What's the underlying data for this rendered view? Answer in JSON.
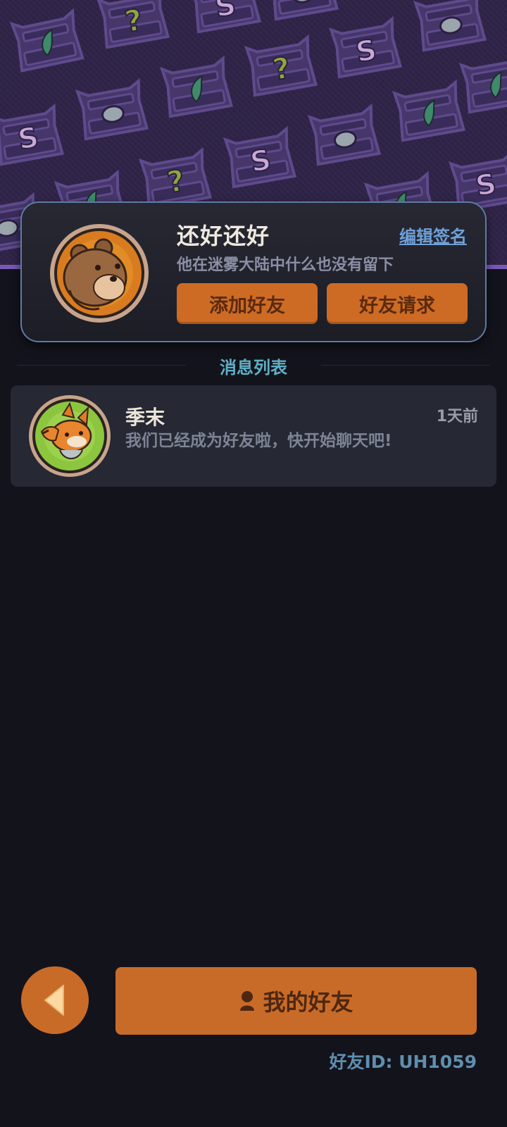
{
  "banner": {
    "tile_symbols": [
      "S",
      "?",
      "gem-icon",
      "leaf-icon"
    ],
    "colors": {
      "background": "#2f2448",
      "accent": "#7a58b8"
    }
  },
  "profile": {
    "name": "还好还好",
    "edit_signature_label": "编辑签名",
    "signature": "他在迷雾大陆中什么也没有留下",
    "add_friend_label": "添加好友",
    "friend_request_label": "好友请求",
    "avatar_icon": "bear-avatar-icon"
  },
  "messages": {
    "title": "消息列表",
    "items": [
      {
        "name": "季末",
        "time": "1天前",
        "preview": "我们已经成为好友啦，快开始聊天吧!",
        "avatar_icon": "fox-avatar-icon"
      }
    ]
  },
  "bottom": {
    "back_icon": "back-arrow-icon",
    "my_friends_label": "我的好友",
    "friend_id": "好友ID: UH1059"
  },
  "colors": {
    "orange": "#cd6b24",
    "link_blue": "#6fa0d8",
    "section_teal": "#5fb0c4",
    "page_background": "#13131c"
  }
}
